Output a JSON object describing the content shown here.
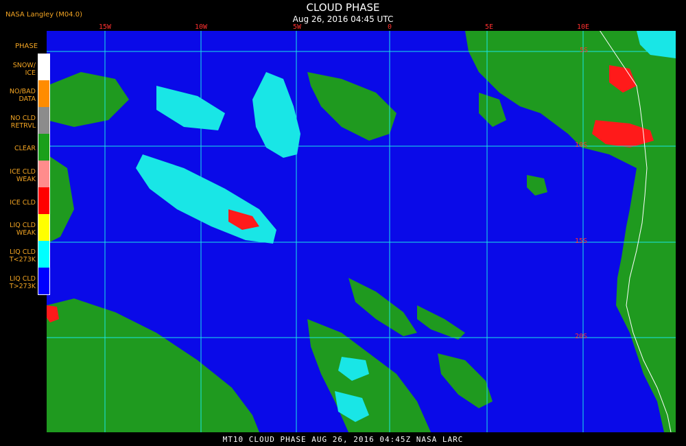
{
  "credit": "NASA Langley (M04.0)",
  "title": "CLOUD PHASE",
  "subtitle": "Aug 26, 2016 04:45 UTC",
  "footer": "MT10  CLOUD PHASE  AUG 26, 2016 04:45Z  NASA LARC",
  "legend": {
    "title": "PHASE",
    "items": [
      {
        "label": "SNOW/ ICE",
        "color": "#ffffff"
      },
      {
        "label": "NO/BAD DATA",
        "color": "#ff8c00"
      },
      {
        "label": "NO CLD RETRVL",
        "color": "#8c8c8c"
      },
      {
        "label": "CLEAR",
        "color": "#1aa01a"
      },
      {
        "label": "ICE CLD WEAK",
        "color": "#ff8c8c"
      },
      {
        "label": "ICE CLD",
        "color": "#ff0000"
      },
      {
        "label": "LIQ CLD WEAK",
        "color": "#ffff00"
      },
      {
        "label": "LIQ CLD T<273K",
        "color": "#00ffff"
      },
      {
        "label": "LIQ CLD T>273K",
        "color": "#0000ff"
      }
    ]
  },
  "lon_ticks": [
    "15W",
    "10W",
    "5W",
    "0",
    "5E",
    "10E"
  ],
  "lat_ticks": [
    "5S",
    "10S",
    "15S",
    "20S"
  ],
  "colors": {
    "ocean": "#0a0ae8",
    "clear": "#1f9a1f",
    "liq_cold": "#19e6e6",
    "ice": "#ff1a1a",
    "grid": "#19e6e6",
    "coast": "#ffffff",
    "tick": "#ff3030"
  }
}
